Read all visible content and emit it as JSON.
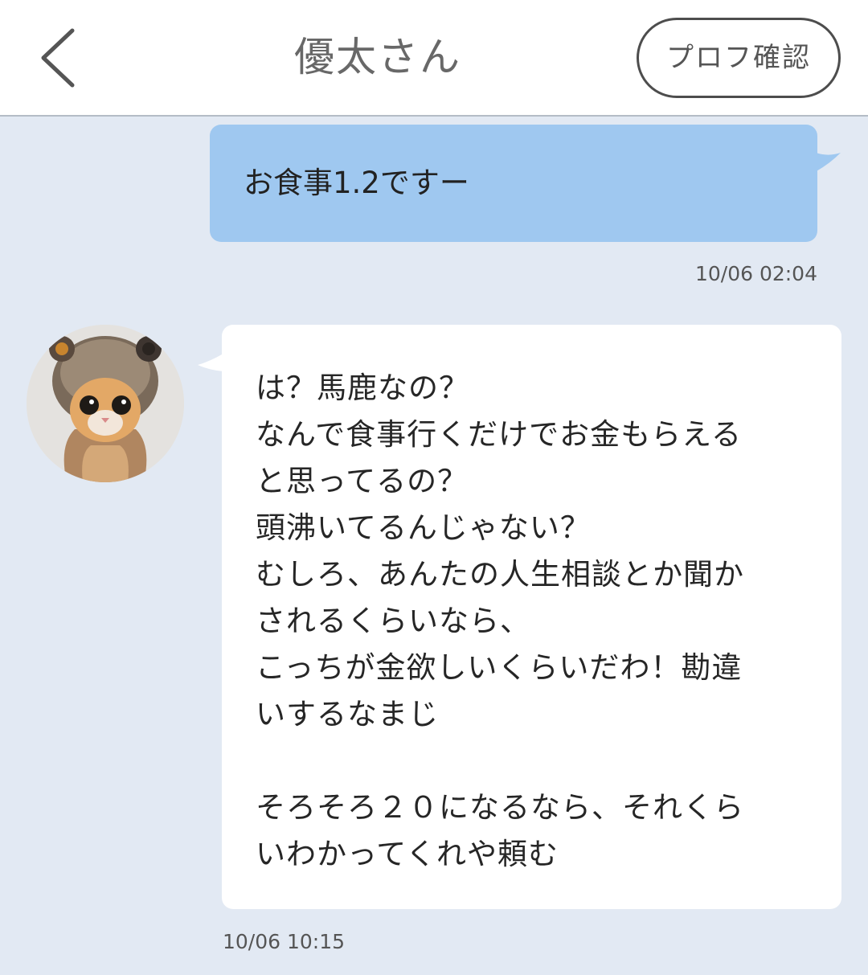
{
  "header": {
    "title": "優太さん",
    "profile_button": "プロフ確認"
  },
  "messages": [
    {
      "direction": "outgoing",
      "text": "お食事1.2ですー",
      "time": "10/06 02:04"
    },
    {
      "direction": "incoming",
      "lines": [
        "は？馬鹿なの？",
        "なんで食事行くだけでお金もらえる",
        "と思ってるの？",
        "頭沸いてるんじゃない？",
        "むしろ、あんたの人生相談とか聞か",
        "されるくらいなら、",
        "こっちが金欲しいくらいだわ！勘違",
        "いするなまじ",
        "",
        "そろそろ２０になるなら、それくら",
        "いわかってくれや頼む"
      ],
      "time": "10/06 10:15"
    }
  ],
  "colors": {
    "background": "#e2e9f3",
    "outgoing_bubble": "#9fc8f0",
    "incoming_bubble": "#ffffff"
  }
}
